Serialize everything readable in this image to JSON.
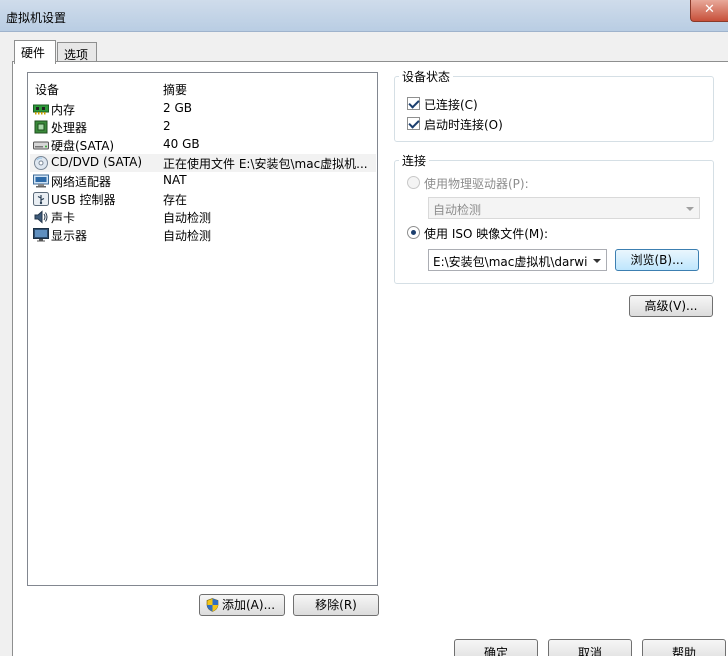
{
  "window": {
    "title": "虚拟机设置",
    "close_glyph": "✕"
  },
  "tabs": [
    {
      "label": "硬件",
      "active": true
    },
    {
      "label": "选项",
      "active": false
    }
  ],
  "device_list": {
    "columns": {
      "device": "设备",
      "summary": "摘要"
    },
    "rows": [
      {
        "name": "内存",
        "summary": "2 GB",
        "icon": "memory-icon"
      },
      {
        "name": "处理器",
        "summary": "2",
        "icon": "processor-icon"
      },
      {
        "name": "硬盘(SATA)",
        "summary": "40 GB",
        "icon": "hard-disk-icon"
      },
      {
        "name": "CD/DVD (SATA)",
        "summary": "正在使用文件 E:\\安装包\\mac虚拟机...",
        "icon": "cd-dvd-icon",
        "selected": true
      },
      {
        "name": "网络适配器",
        "summary": "NAT",
        "icon": "network-adapter-icon"
      },
      {
        "name": "USB 控制器",
        "summary": "存在",
        "icon": "usb-icon"
      },
      {
        "name": "声卡",
        "summary": "自动检测",
        "icon": "sound-card-icon"
      },
      {
        "name": "显示器",
        "summary": "自动检测",
        "icon": "display-icon"
      }
    ]
  },
  "list_buttons": {
    "add": "添加(A)...",
    "remove": "移除(R)"
  },
  "device_status": {
    "legend": "设备状态",
    "connected": {
      "label": "已连接(C)",
      "checked": true
    },
    "connect_on_power": {
      "label": "启动时连接(O)",
      "checked": true
    }
  },
  "connection": {
    "legend": "连接",
    "physical_drive": {
      "label": "使用物理驱动器(P):",
      "selected": false,
      "combo_value": "自动检测"
    },
    "iso_image": {
      "label": "使用 ISO 映像文件(M):",
      "selected": true,
      "path": "E:\\安装包\\mac虚拟机\\darwir"
    },
    "browse": "浏览(B)..."
  },
  "advanced": "高级(V)...",
  "footer": {
    "ok": "确定",
    "cancel": "取消",
    "help": "帮助"
  },
  "colors": {
    "titlebar": "#c4d5e8",
    "close": "#c7503a",
    "selection": "#f2f2f2"
  }
}
